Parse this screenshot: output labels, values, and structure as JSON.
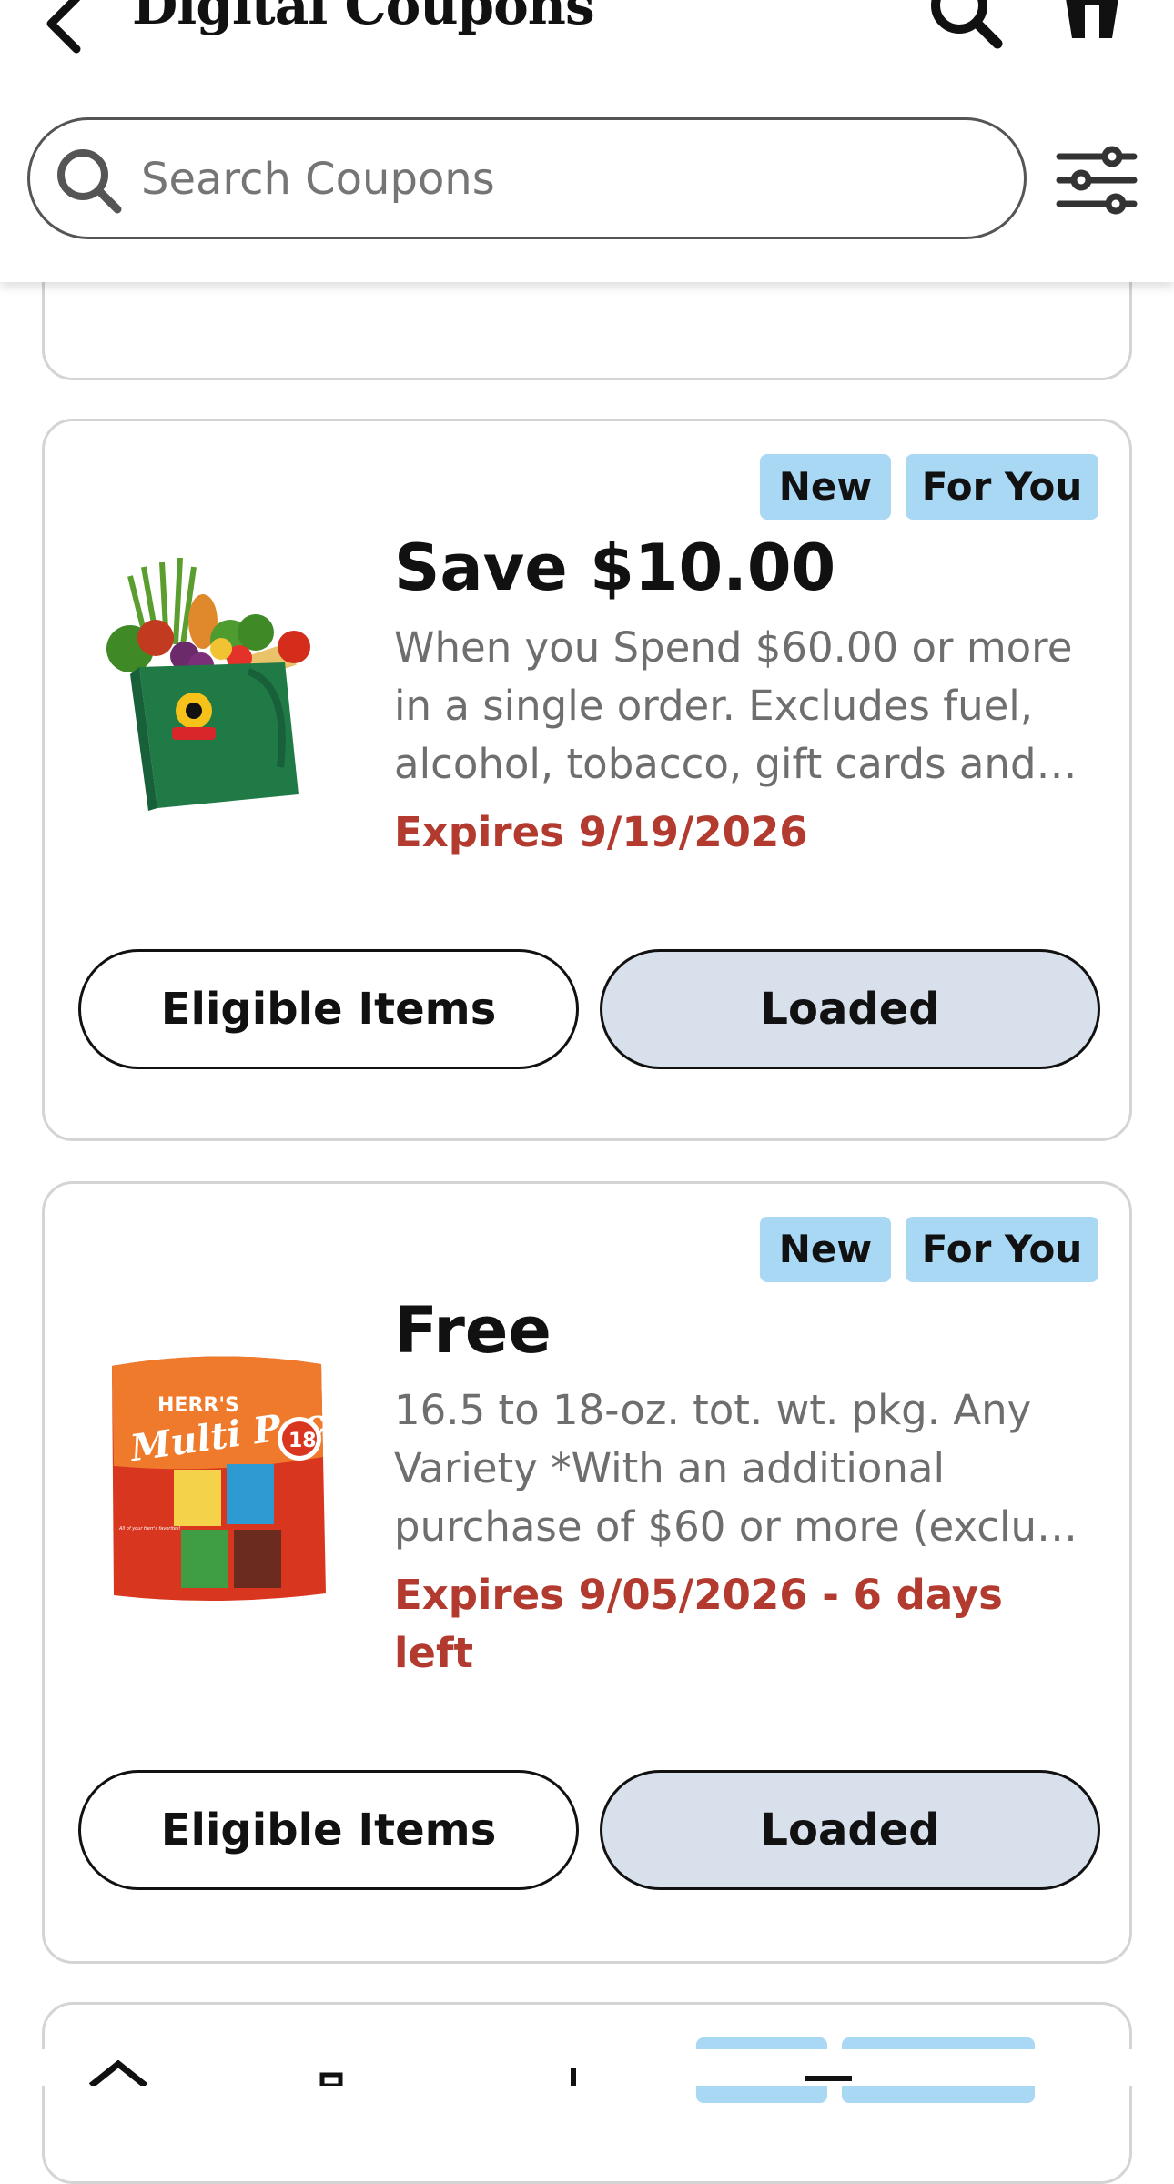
{
  "header": {
    "title": "Digital Coupons",
    "back_icon": "chevron-left-icon",
    "search_icon": "search-icon",
    "cart_icon": "cart-icon"
  },
  "search": {
    "placeholder": "Search Coupons",
    "value": "",
    "filter_icon": "sliders-icon"
  },
  "colors": {
    "badge_bg": "#a9d8f4",
    "expiry": "#b23a2e",
    "loaded_bg": "#d8e0ec",
    "desc": "#6e6e6e"
  },
  "coupons": [
    {
      "badges": [
        "New",
        "For You"
      ],
      "title": "Save $10.00",
      "description": "When you Spend $60.00 or more in a single order. Excludes fuel, alcohol, tobacco, gift cards and…",
      "expiry": "Expires 9/19/2026",
      "eligible_label": "Eligible Items",
      "loaded_label": "Loaded",
      "image": "grocery-bag"
    },
    {
      "badges": [
        "New",
        "For You"
      ],
      "title": "Free",
      "description": "16.5 to 18-oz. tot. wt. pkg. Any Variety *With an additional purchase of $60 or more (exclu…",
      "expiry": "Expires 9/05/2026 - 6 days left",
      "eligible_label": "Eligible Items",
      "loaded_label": "Loaded",
      "image": "herrs-multi-pack",
      "image_text": {
        "brand": "HERR'S",
        "product": "Multi Pack",
        "count": "18",
        "tag": "All of your Herr's favorites!"
      }
    }
  ]
}
